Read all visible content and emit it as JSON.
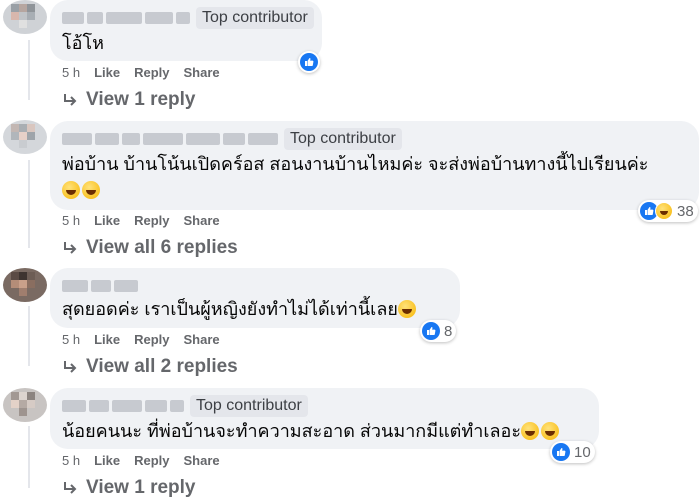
{
  "colors": {
    "bubble": "#f0f2f5",
    "like_blue": "#1877f2",
    "meta_gray": "#65676b"
  },
  "comments": [
    {
      "badge": "Top contributor",
      "text_lines": [
        "โอ้โห"
      ],
      "emojis": [],
      "time": "5 h",
      "like_label": "Like",
      "reply_label": "Reply",
      "share_label": "Share",
      "reaction_icons": [
        "like-icon"
      ],
      "reaction_count": "",
      "replies_label": "View 1 reply"
    },
    {
      "badge": "Top contributor",
      "text_lines": [
        "พ่อบ้าน บ้านโน้นเปิดคร์อส สอนงานบ้านไหมค่ะ จะส่งพ่อบ้านทางนี้ไปเรียนค่ะ",
        ""
      ],
      "emojis": [
        "laughing-emoji",
        "grinning-emoji"
      ],
      "time": "5 h",
      "like_label": "Like",
      "reply_label": "Reply",
      "share_label": "Share",
      "reaction_icons": [
        "like-icon",
        "haha-icon"
      ],
      "reaction_count": "38",
      "replies_label": "View all 6 replies"
    },
    {
      "badge": "",
      "text_lines": [
        "สุดยอดค่ะ เราเป็นผู้หญิงยังทำไม่ได้เท่านี้เลย"
      ],
      "emojis": [
        "tears-of-joy-emoji"
      ],
      "time": "5 h",
      "like_label": "Like",
      "reply_label": "Reply",
      "share_label": "Share",
      "reaction_icons": [
        "like-icon"
      ],
      "reaction_count": "8",
      "replies_label": "View all 2 replies"
    },
    {
      "badge": "Top contributor",
      "text_lines": [
        "น้อยคนนะ ที่พ่อบ้านจะทำความสะอาด ส่วนมากมีแต่ทำเลอะ"
      ],
      "emojis": [
        "grinning-emoji",
        "grinning-emoji"
      ],
      "time": "5 h",
      "like_label": "Like",
      "reply_label": "Reply",
      "share_label": "Share",
      "reaction_icons": [
        "like-icon"
      ],
      "reaction_count": "10",
      "replies_label": "View 1 reply"
    }
  ]
}
